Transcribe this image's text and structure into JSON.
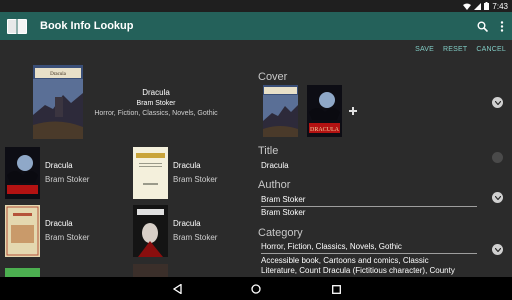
{
  "status_bar": {
    "time": "7:43"
  },
  "app_bar": {
    "title": "Book Info Lookup",
    "search_icon": "search-icon",
    "overflow_icon": "more-vert-icon"
  },
  "actions": {
    "save": "SAVE",
    "reset": "RESET",
    "cancel": "CANCEL"
  },
  "featured": {
    "title": "Dracula",
    "author": "Bram Stoker",
    "genres": "Horror, Fiction, Classics, Novels, Gothic",
    "cover_text": "Dracula"
  },
  "results": [
    {
      "title": "Dracula",
      "author": "Bram Stoker"
    },
    {
      "title": "Dracula",
      "author": "Bram Stoker"
    },
    {
      "title": "Dracula",
      "author": "Bram Stoker"
    },
    {
      "title": "Dracula",
      "author": "Bram Stoker"
    }
  ],
  "cover_section": {
    "label": "Cover",
    "thumb2_text": "DRACULA",
    "add_icon": "plus-icon"
  },
  "title_section": {
    "label": "Title",
    "value": "Dracula"
  },
  "author_section": {
    "label": "Author",
    "value1": "Bram Stoker",
    "value2": "Bram Stoker"
  },
  "category_section": {
    "label": "Category",
    "value1": "Horror, Fiction, Classics, Novels, Gothic",
    "value2_line1": "Accessible book, Cartoons and comics, Classic",
    "value2_line2": "Literature, Count Dracula (Fictitious character), County"
  },
  "colors": {
    "app_bar": "#24615a",
    "accent": "#80cbc4",
    "background": "#2b2b2b"
  }
}
